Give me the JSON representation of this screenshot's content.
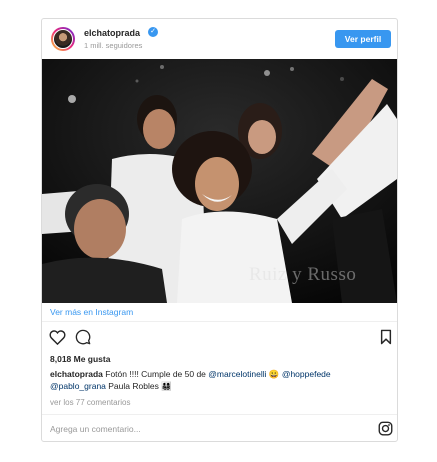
{
  "header": {
    "username": "elchatoprada",
    "verified_mark": "✓",
    "followers": "1 mill. seguidores",
    "view_profile_label": "Ver perfil"
  },
  "photo": {
    "watermark": "Ruiz y Russo"
  },
  "link": {
    "see_more": "Ver más en Instagram"
  },
  "actions": {
    "like_icon": "heart-icon",
    "comment_icon": "comment-bubble-icon",
    "save_icon": "bookmark-icon"
  },
  "likes": "8,018 Me gusta",
  "caption": {
    "user": "elchatoprada",
    "text1": " Fotón !!!! Cumple de 50 de ",
    "mention1": "@marcelotinelli",
    "text2": " 😀 ",
    "mention2": "@hoppefede",
    "mention3": "@pablo_grana",
    "text3": " Paula Robles 👨‍👩‍👧‍👦"
  },
  "comments_link": "ver los 77 comentarios",
  "comment_box": {
    "placeholder": "Agrega un comentario...",
    "instagram_icon": "instagram-icon"
  },
  "colors": {
    "accent": "#3897f0",
    "mention": "#003569",
    "muted": "#999999",
    "border": "#dbdbdb"
  }
}
